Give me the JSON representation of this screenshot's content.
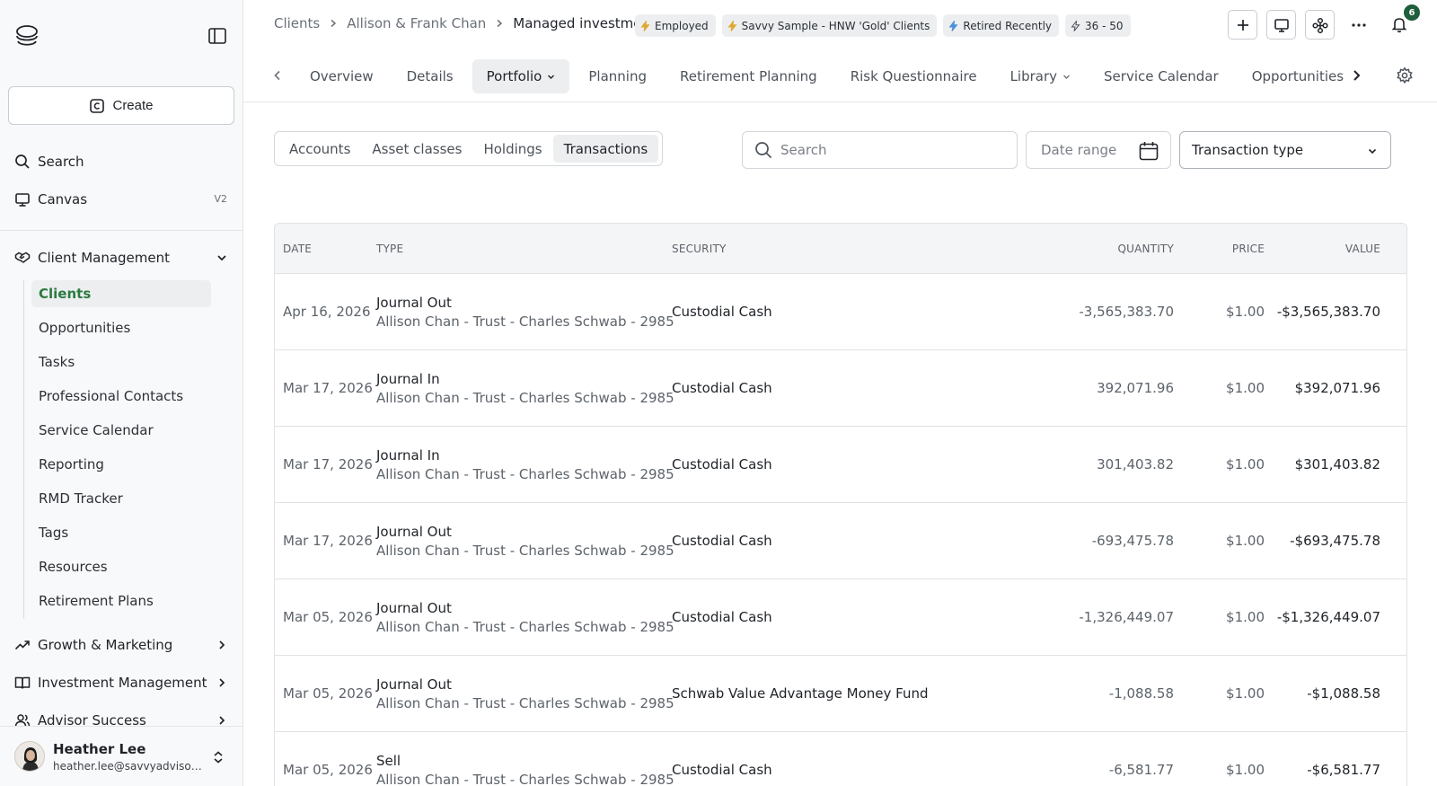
{
  "sidebar": {
    "create_label": "Create",
    "search_label": "Search",
    "canvas_label": "Canvas",
    "canvas_badge": "V2",
    "client_management_label": "Client Management",
    "client_management_items": [
      "Clients",
      "Opportunities",
      "Tasks",
      "Professional Contacts",
      "Service Calendar",
      "Reporting",
      "RMD Tracker",
      "Tags",
      "Resources",
      "Retirement Plans"
    ],
    "active_item": "Clients",
    "growth_label": "Growth & Marketing",
    "investment_label": "Investment Management",
    "advisor_label": "Advisor Success",
    "user": {
      "name": "Heather Lee",
      "email": "heather.lee@savvyadvisors.com"
    }
  },
  "header": {
    "breadcrumb": [
      "Clients",
      "Allison & Frank Chan",
      "Managed investments"
    ],
    "tags": [
      "Employed",
      "Savvy Sample - HNW 'Gold' Clients",
      "Retired Recently",
      "36 - 50"
    ],
    "notification_count": "6"
  },
  "tabs": [
    {
      "label": "Overview",
      "dropdown": false
    },
    {
      "label": "Details",
      "dropdown": false
    },
    {
      "label": "Portfolio",
      "dropdown": true,
      "active": true
    },
    {
      "label": "Planning",
      "dropdown": false
    },
    {
      "label": "Retirement Planning",
      "dropdown": false
    },
    {
      "label": "Risk Questionnaire",
      "dropdown": false
    },
    {
      "label": "Library",
      "dropdown": true
    },
    {
      "label": "Service Calendar",
      "dropdown": false
    },
    {
      "label": "Opportunities",
      "dropdown": false
    }
  ],
  "filters": {
    "segments": [
      "Accounts",
      "Asset classes",
      "Holdings",
      "Transactions"
    ],
    "active_segment": "Transactions",
    "search_placeholder": "Search",
    "date_range_placeholder": "Date range",
    "transaction_type_label": "Transaction type"
  },
  "table": {
    "columns": [
      "Date",
      "Type",
      "Security",
      "Quantity",
      "Price",
      "Value"
    ],
    "rows": [
      {
        "date": "Apr 16, 2026",
        "type": "Journal Out",
        "account": "Allison Chan - Trust - Charles Schwab - 2985",
        "security": "Custodial Cash",
        "quantity": "-3,565,383.70",
        "price": "$1.00",
        "value": "-$3,565,383.70"
      },
      {
        "date": "Mar 17, 2026",
        "type": "Journal In",
        "account": "Allison Chan - Trust - Charles Schwab - 2985",
        "security": "Custodial Cash",
        "quantity": "392,071.96",
        "price": "$1.00",
        "value": "$392,071.96"
      },
      {
        "date": "Mar 17, 2026",
        "type": "Journal In",
        "account": "Allison Chan - Trust - Charles Schwab - 2985",
        "security": "Custodial Cash",
        "quantity": "301,403.82",
        "price": "$1.00",
        "value": "$301,403.82"
      },
      {
        "date": "Mar 17, 2026",
        "type": "Journal Out",
        "account": "Allison Chan - Trust - Charles Schwab - 2985",
        "security": "Custodial Cash",
        "quantity": "-693,475.78",
        "price": "$1.00",
        "value": "-$693,475.78"
      },
      {
        "date": "Mar 05, 2026",
        "type": "Journal Out",
        "account": "Allison Chan - Trust - Charles Schwab - 2985",
        "security": "Custodial Cash",
        "quantity": "-1,326,449.07",
        "price": "$1.00",
        "value": "-$1,326,449.07"
      },
      {
        "date": "Mar 05, 2026",
        "type": "Journal Out",
        "account": "Allison Chan - Trust - Charles Schwab - 2985",
        "security": "Schwab Value Advantage Money Fund",
        "quantity": "-1,088.58",
        "price": "$1.00",
        "value": "-$1,088.58"
      },
      {
        "date": "Mar 05, 2026",
        "type": "Sell",
        "account": "Allison Chan - Trust - Charles Schwab - 2985",
        "security": "Custodial Cash",
        "quantity": "-6,581.77",
        "price": "$1.00",
        "value": "-$6,581.77"
      }
    ]
  },
  "icons": {
    "logo": "brand-logo-icon",
    "collapse": "sidebar-toggle-icon",
    "create": "copyright-icon",
    "search": "search-icon",
    "canvas": "canvas-icon",
    "client_management": "handshake-icon",
    "growth": "trending-up-icon",
    "investment": "book-icon",
    "advisor": "users-icon",
    "tag": "bolt-icon",
    "add": "plus-icon",
    "presentation": "presentation-icon",
    "workflow": "workflow-icon",
    "more": "more-icon",
    "notifications": "bell-icon",
    "settings": "gear-icon",
    "calendar": "calendar-icon"
  },
  "colors": {
    "accent": "#2b7a3f",
    "badge": "#1f5e3b",
    "bolt": "#e0a82e"
  }
}
